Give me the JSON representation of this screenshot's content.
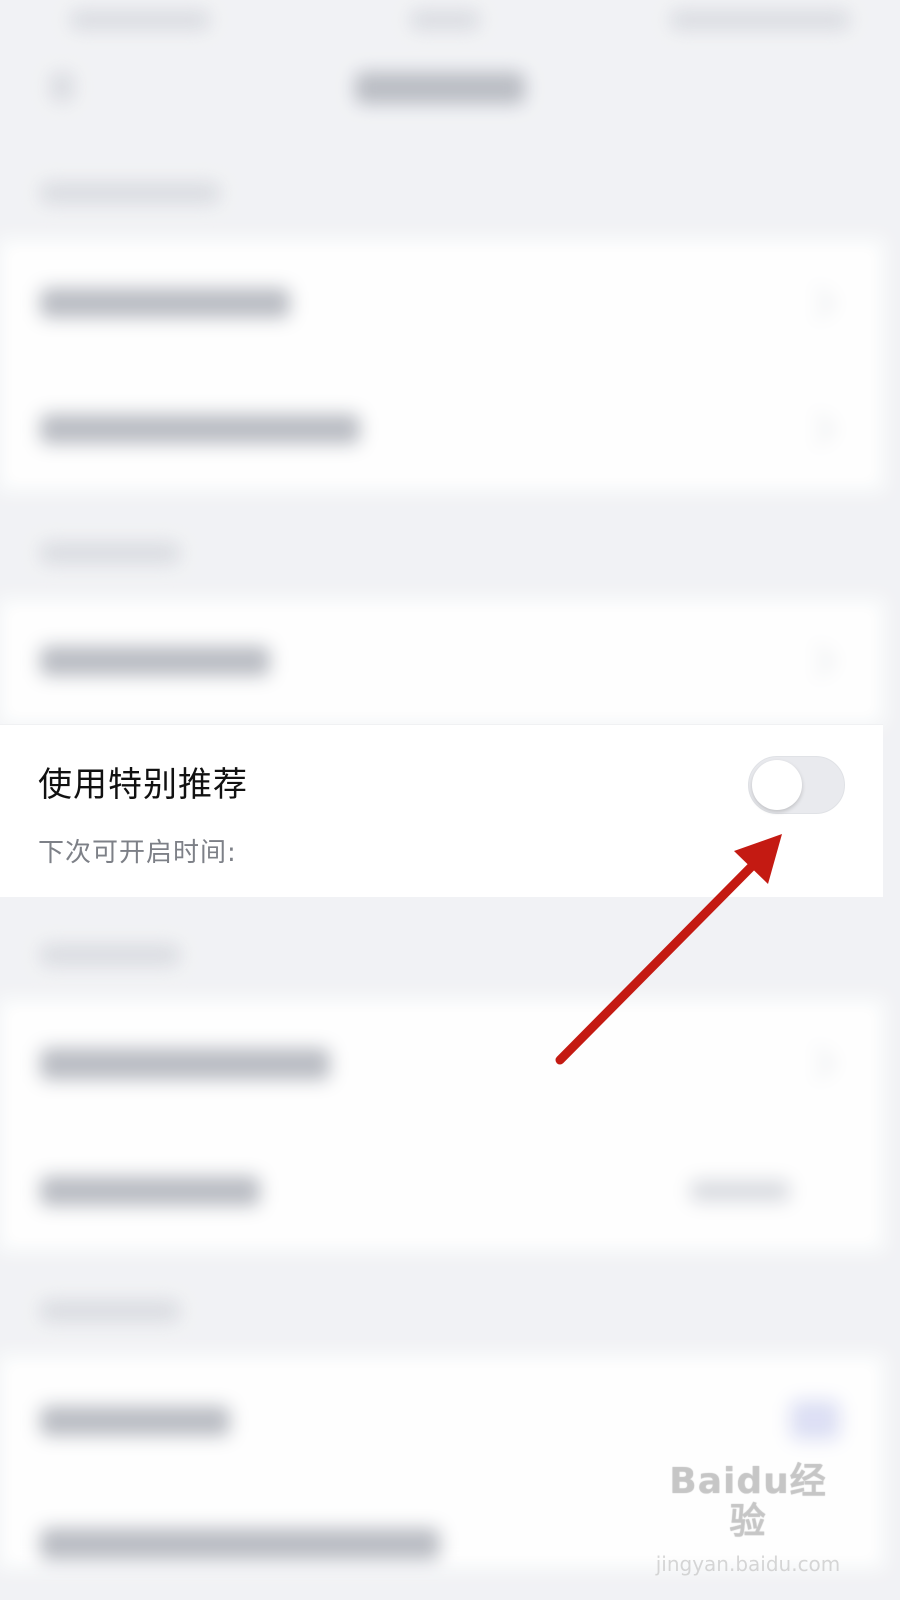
{
  "setting": {
    "title": "使用特别推荐",
    "subtitle": "下次可开启时间:",
    "toggle_on": false
  },
  "annotation": {
    "arrow_color": "#c41a12"
  },
  "watermark": {
    "logo_text": "Baidu经验",
    "site": "jingyan.baidu.com"
  },
  "colors": {
    "background": "#f1f2f5",
    "card": "#ffffff",
    "title_text": "#111111",
    "sub_text": "#7d8087",
    "toggle_track": "#e9eaee"
  }
}
